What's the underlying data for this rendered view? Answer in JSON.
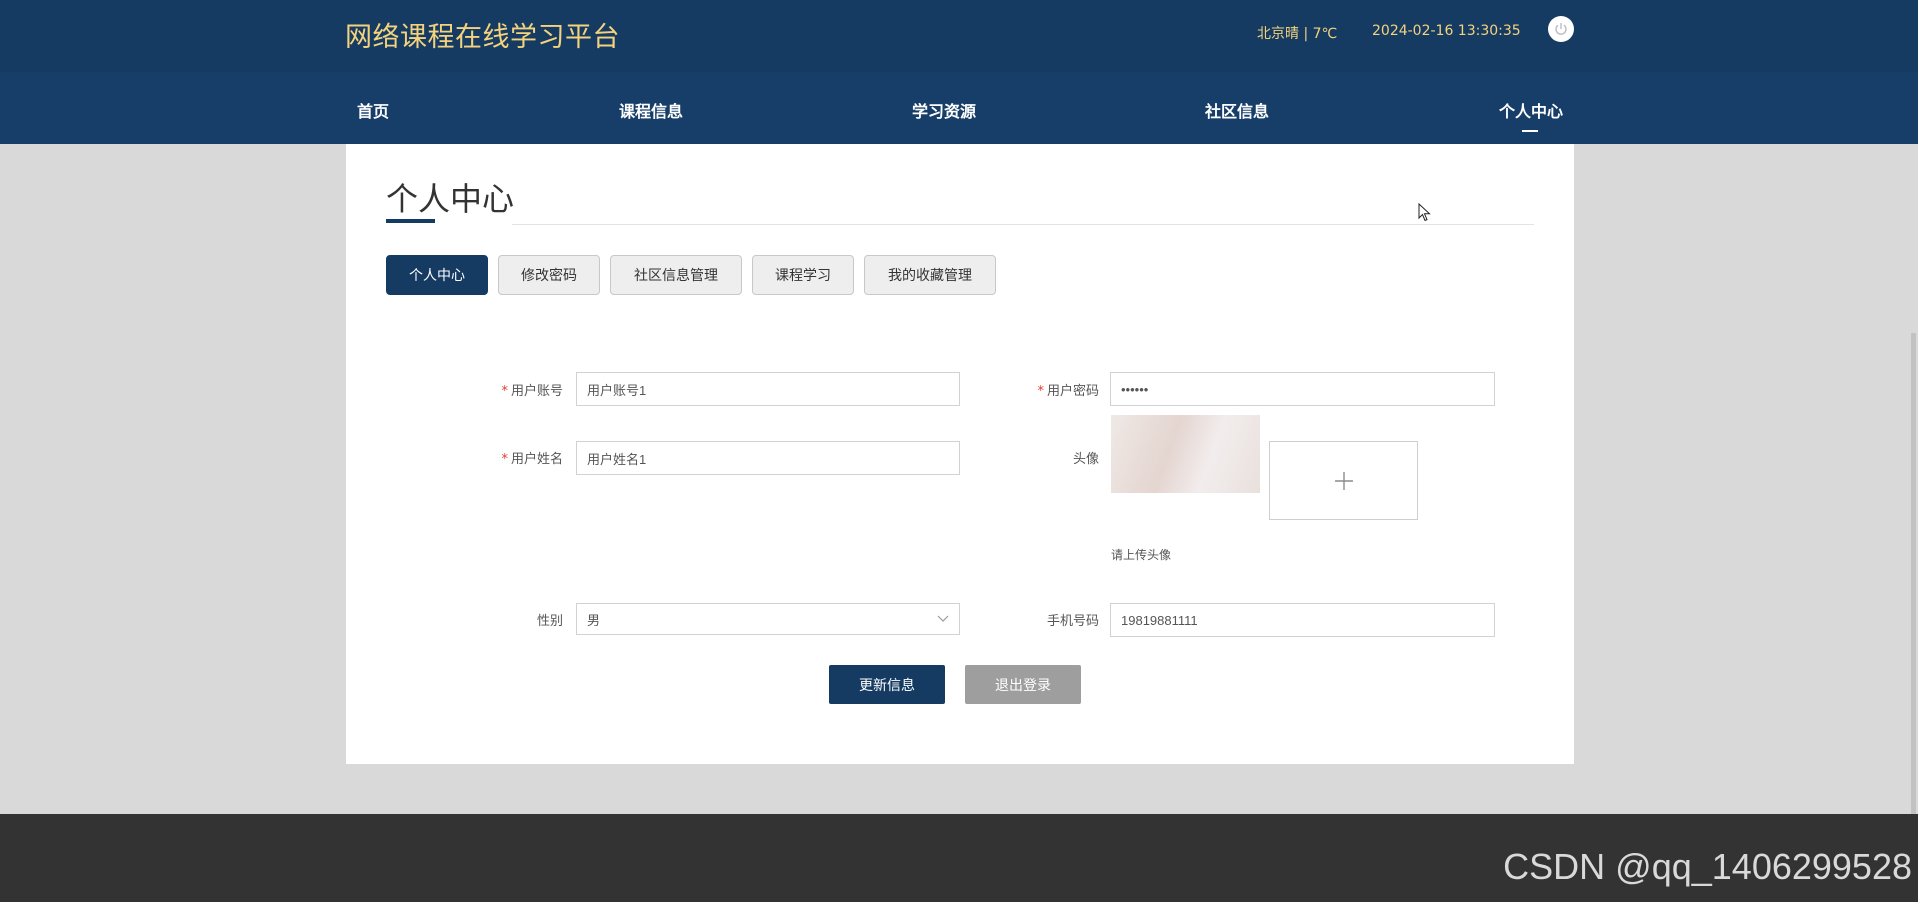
{
  "header": {
    "site_title": "网络课程在线学习平台",
    "weather": "北京晴 | 7℃",
    "datetime": "2024-02-16  13:30:35",
    "power_icon": "power-icon"
  },
  "nav": {
    "items": [
      "首页",
      "课程信息",
      "学习资源",
      "社区信息",
      "个人中心"
    ],
    "active": "个人中心"
  },
  "page": {
    "title": "个人中心"
  },
  "tabs": {
    "items": [
      "个人中心",
      "修改密码",
      "社区信息管理",
      "课程学习",
      "我的收藏管理"
    ],
    "active": "个人中心"
  },
  "form": {
    "account_label": "用户账号",
    "account_value": "用户账号1",
    "password_label": "用户密码",
    "password_value": "••••••",
    "name_label": "用户姓名",
    "name_value": "用户姓名1",
    "avatar_label": "头像",
    "avatar_hint": "请上传头像",
    "upload_icon": "plus-icon",
    "gender_label": "性别",
    "gender_value": "男",
    "phone_label": "手机号码",
    "phone_value": "19819881111",
    "required_mark": "*"
  },
  "buttons": {
    "update": "更新信息",
    "logout": "退出登录"
  },
  "watermark": "CSDN @qq_1406299528",
  "colors": {
    "primary": "#163b63",
    "accent_gold": "#f4d37c",
    "required": "#e8392f",
    "secondary_button": "#9e9e9e",
    "footer": "#333333"
  }
}
